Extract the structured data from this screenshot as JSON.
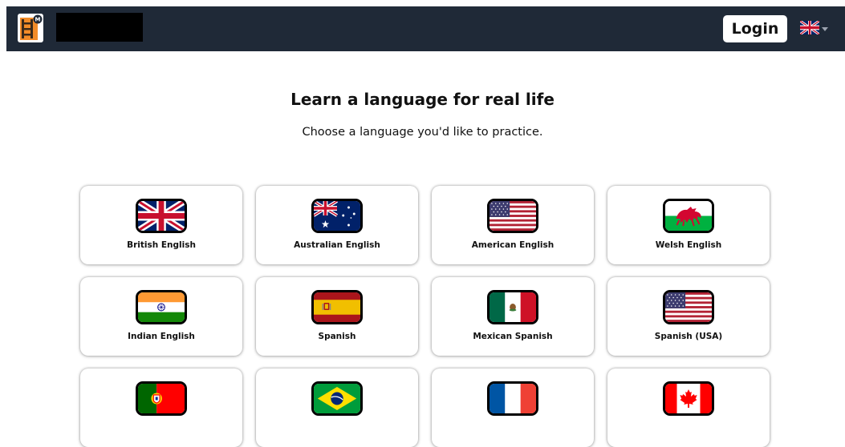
{
  "navbar": {
    "logo_icon": "ladder-book-icon",
    "login_label": "Login",
    "language_flag": "uk-flag-icon"
  },
  "main": {
    "title": "Learn a language for real life",
    "subtitle": "Choose a language you'd like to practice."
  },
  "languages": [
    {
      "label": "British English",
      "flag": "uk"
    },
    {
      "label": "Australian English",
      "flag": "au"
    },
    {
      "label": "American English",
      "flag": "us"
    },
    {
      "label": "Welsh English",
      "flag": "wales"
    },
    {
      "label": "Indian English",
      "flag": "in"
    },
    {
      "label": "Spanish",
      "flag": "es"
    },
    {
      "label": "Mexican Spanish",
      "flag": "mx"
    },
    {
      "label": "Spanish (USA)",
      "flag": "us"
    },
    {
      "label": "",
      "flag": "pt"
    },
    {
      "label": "",
      "flag": "br"
    },
    {
      "label": "",
      "flag": "fr"
    },
    {
      "label": "",
      "flag": "ca"
    }
  ],
  "colors": {
    "navbar_bg": "#1f2937",
    "page_bg": "#ffffff",
    "button_bg": "#ffffff"
  }
}
